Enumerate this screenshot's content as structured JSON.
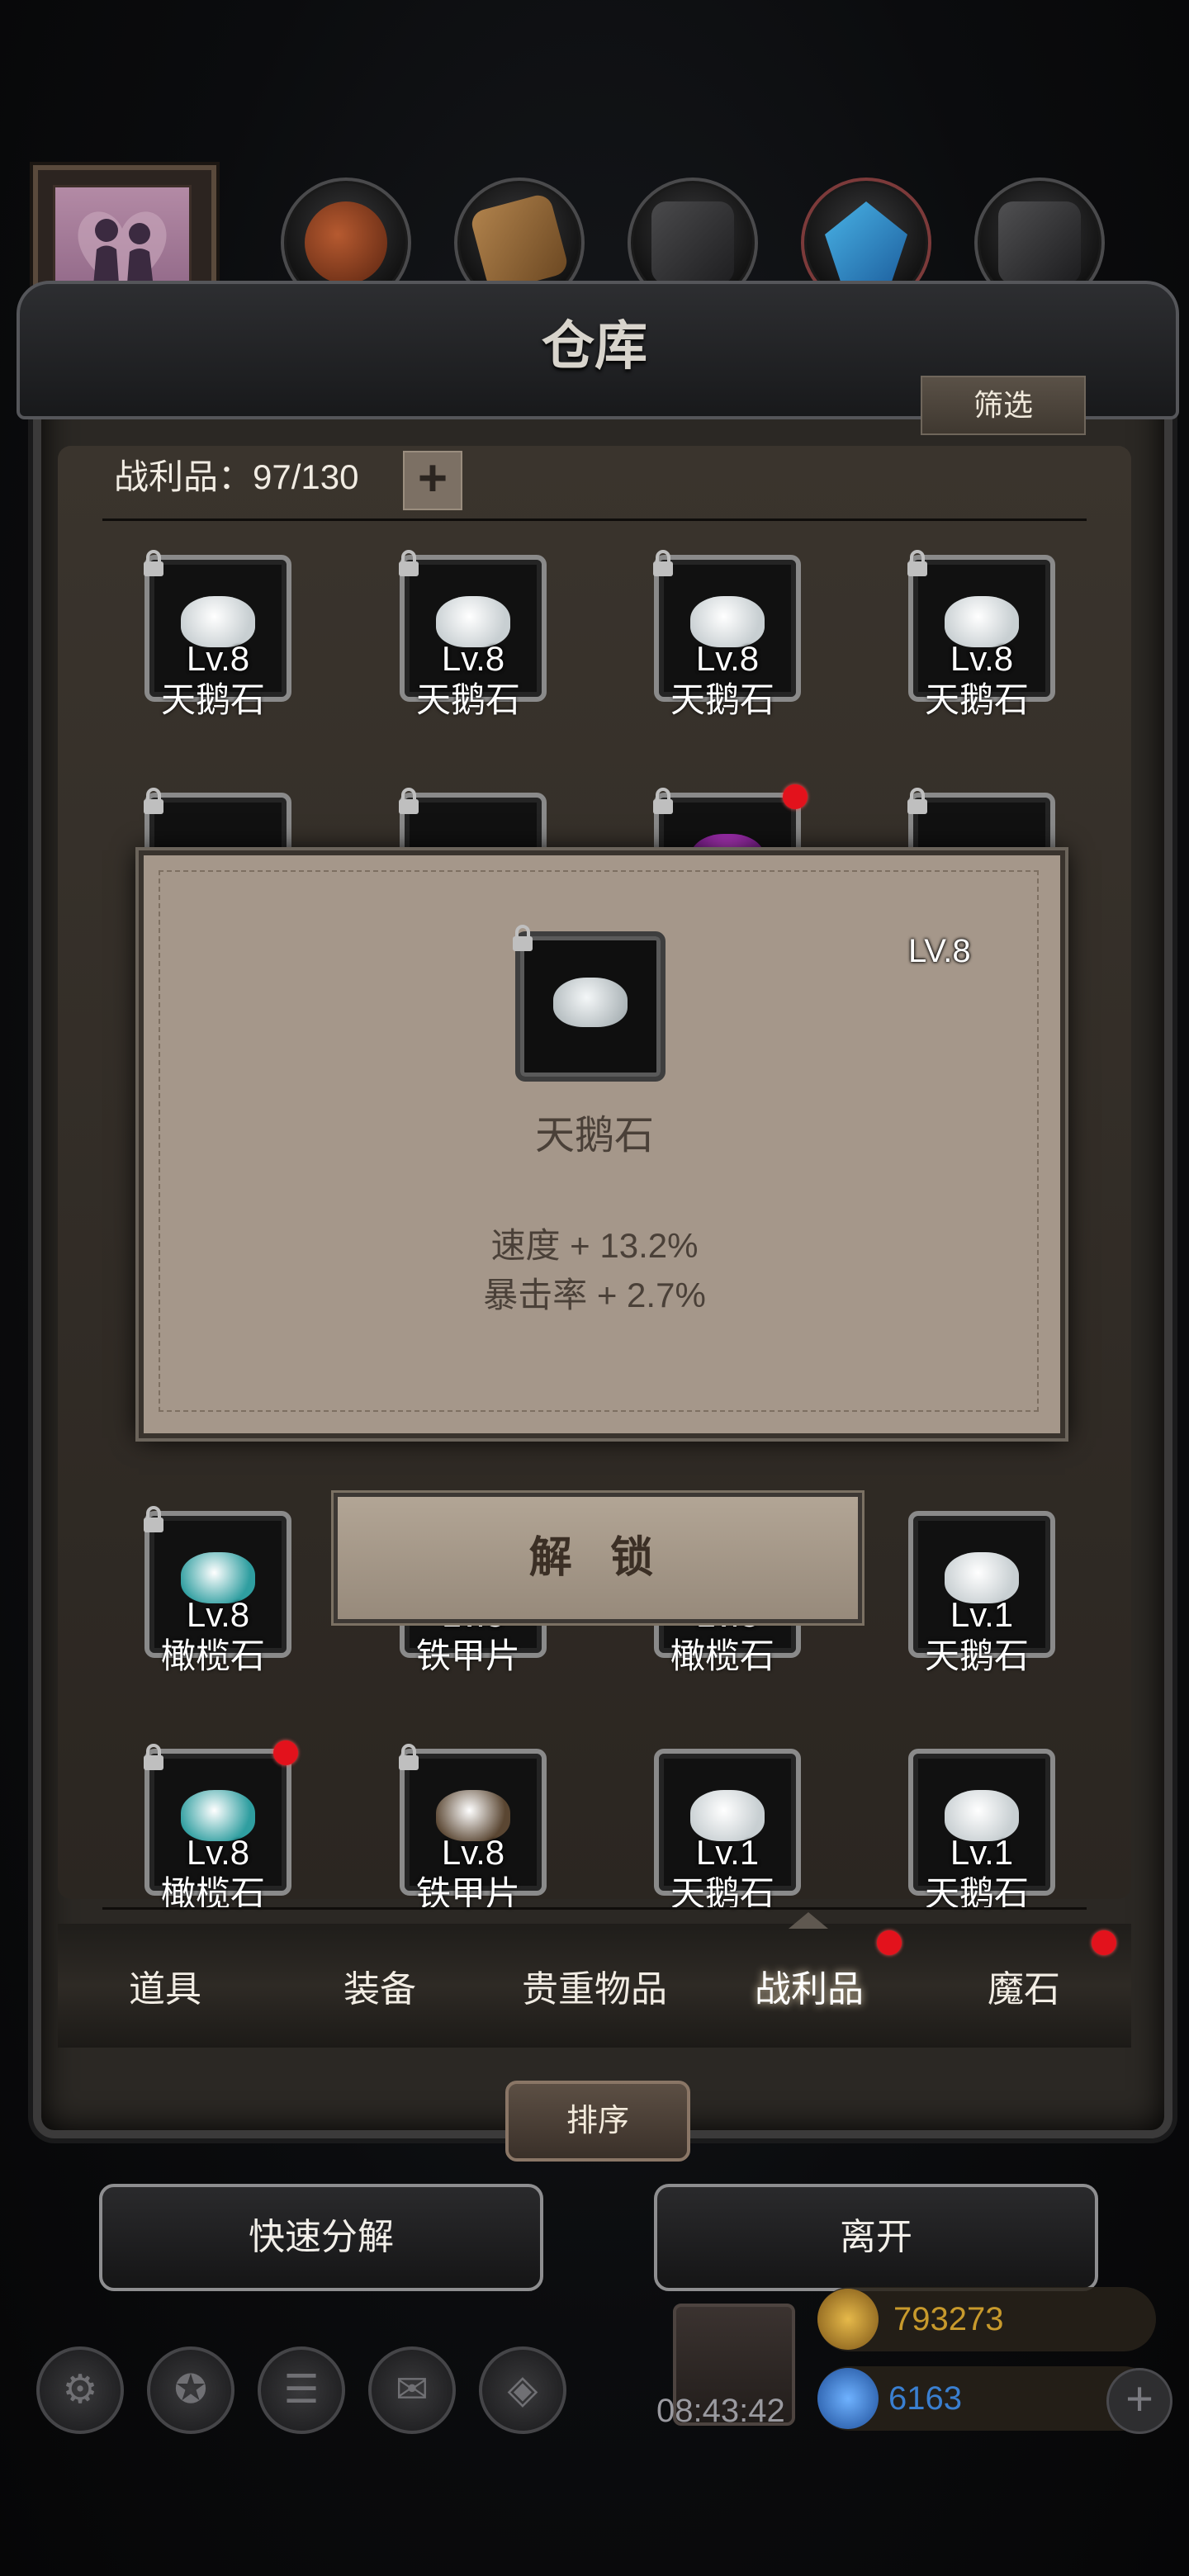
{
  "header": {
    "title": "仓库",
    "filter_label": "筛选"
  },
  "inventory": {
    "count_label": "战利品：97/130",
    "add_label": "+"
  },
  "top_categories": [
    {
      "icon": "portrait-icon"
    },
    {
      "icon": "leather-icon"
    },
    {
      "icon": "wood-icon"
    },
    {
      "icon": "stone-icon"
    },
    {
      "icon": "crystal-icon"
    },
    {
      "icon": "ore-icon"
    }
  ],
  "rows": [
    [
      {
        "level": "Lv.8",
        "name": "天鹅石",
        "gem": "#c8cfd2",
        "locked": true,
        "dot": false
      },
      {
        "level": "Lv.8",
        "name": "天鹅石",
        "gem": "#c8cfd2",
        "locked": true,
        "dot": false
      },
      {
        "level": "Lv.8",
        "name": "天鹅石",
        "gem": "#c8cfd2",
        "locked": true,
        "dot": false
      },
      {
        "level": "Lv.8",
        "name": "天鹅石",
        "gem": "#c8cfd2",
        "locked": true,
        "dot": false
      }
    ],
    [
      {
        "level": "Lv.8",
        "name": "橄榄石",
        "gem": "#2f9ea0",
        "locked": true,
        "dot": false
      },
      {
        "level": "Lv.8",
        "name": "铁甲片",
        "gem": "#4a3c30",
        "locked": true,
        "dot": false
      },
      {
        "level": "Lv.8",
        "name": "橄榄石",
        "gem": "#2f9ea0",
        "locked": true,
        "dot": false
      },
      {
        "level": "Lv.1",
        "name": "天鹅石",
        "gem": "#c8cfd2",
        "locked": false,
        "dot": false
      }
    ],
    [
      {
        "level": "Lv.8",
        "name": "橄榄石",
        "gem": "#2f9ea0",
        "locked": true,
        "dot": true
      },
      {
        "level": "Lv.8",
        "name": "铁甲片",
        "gem": "#5a4632",
        "locked": true,
        "dot": false
      },
      {
        "level": "Lv.1",
        "name": "天鹅石",
        "gem": "#c8cfd2",
        "locked": false,
        "dot": false
      },
      {
        "level": "Lv.1",
        "name": "天鹅石",
        "gem": "#c8cfd2",
        "locked": false,
        "dot": false
      }
    ]
  ],
  "detail": {
    "level": "LV.8",
    "name": "天鹅石",
    "stats": [
      "速度 + 13.2%",
      "暴击率 + 2.7%"
    ],
    "unlock_label": "解 锁"
  },
  "tabs": [
    {
      "label": "道具",
      "active": false,
      "dot": false
    },
    {
      "label": "装备",
      "active": false,
      "dot": false
    },
    {
      "label": "贵重物品",
      "active": false,
      "dot": false
    },
    {
      "label": "战利品",
      "active": true,
      "dot": true
    },
    {
      "label": "魔石",
      "active": false,
      "dot": true
    }
  ],
  "actions": {
    "sort_label": "排序",
    "quick_decompose_label": "快速分解",
    "leave_label": "离开"
  },
  "hud": {
    "time": "08:43:42",
    "gold": "793273",
    "gems": "6163",
    "gold_color": "#c89a2c",
    "gem_color": "#3a7fd0"
  }
}
